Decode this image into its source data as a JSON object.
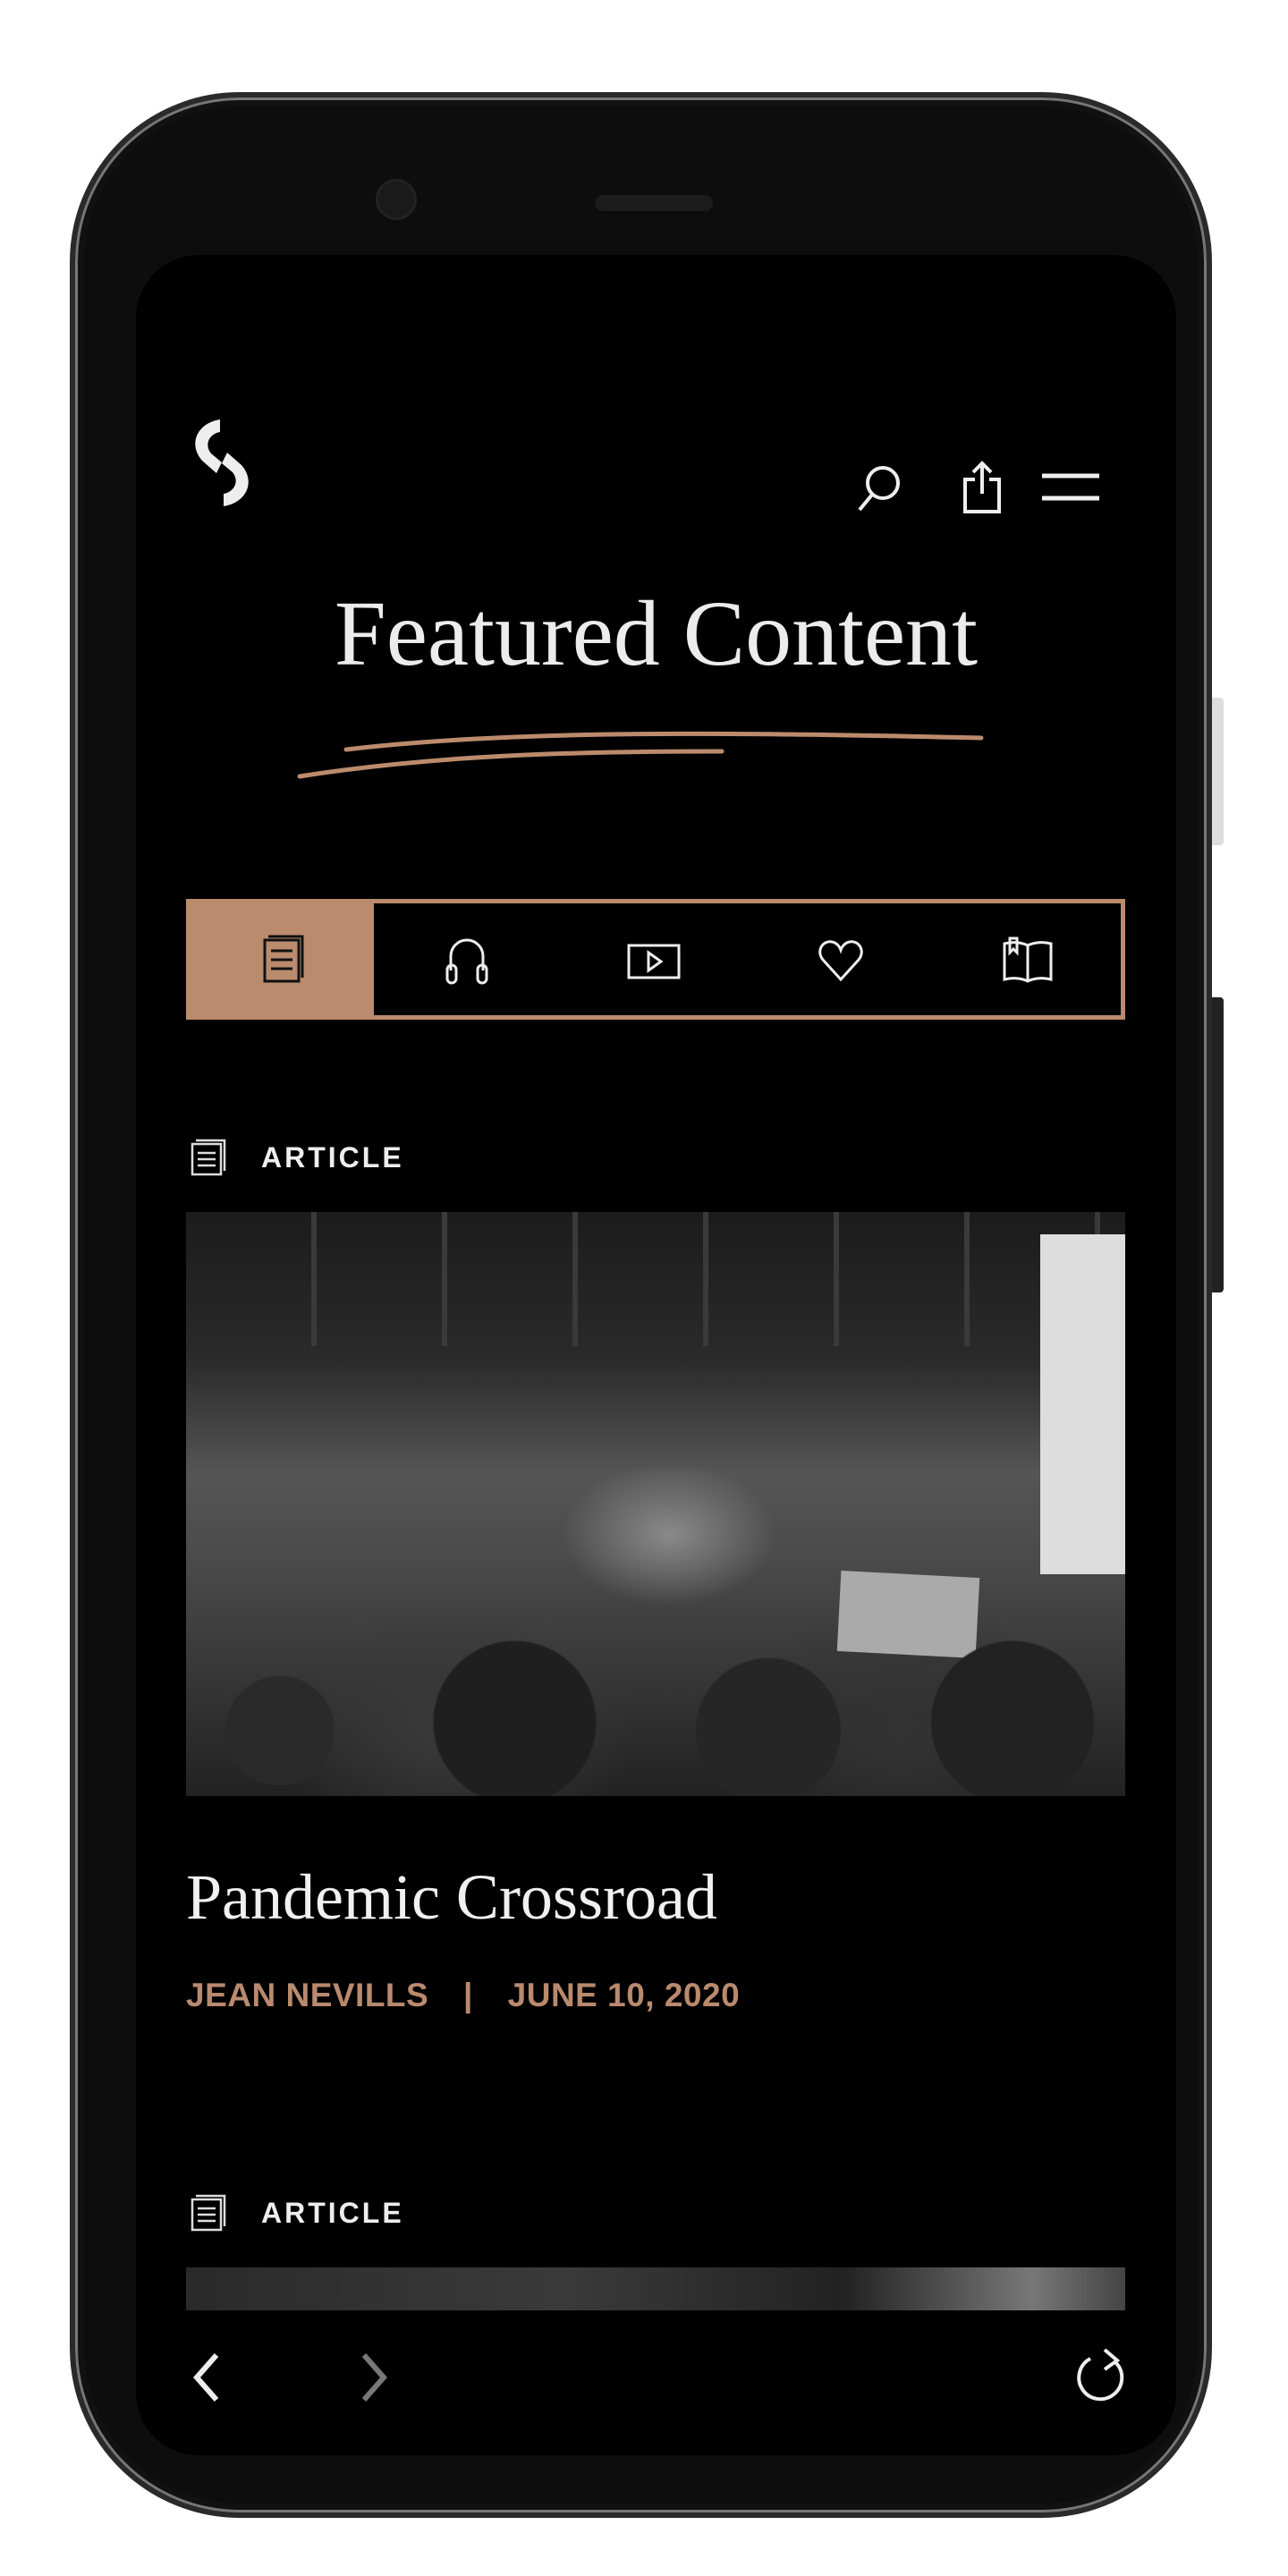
{
  "header": {
    "logo": "S",
    "icons": [
      "search-icon",
      "share-icon",
      "menu-icon"
    ]
  },
  "title": "Featured Content",
  "accent_color": "#bb8b6d",
  "tabs": [
    {
      "icon": "article-icon",
      "active": true
    },
    {
      "icon": "headphones-icon"
    },
    {
      "icon": "video-icon"
    },
    {
      "icon": "heart-icon"
    },
    {
      "icon": "book-icon"
    }
  ],
  "articles": [
    {
      "type": "ARTICLE",
      "title": "Pandemic Crossroad",
      "author": "JEAN NEVILLS",
      "separator": "|",
      "date": "JUNE 10, 2020"
    },
    {
      "type": "ARTICLE"
    }
  ],
  "browser_nav": {
    "icons": [
      "back-icon",
      "forward-icon",
      "refresh-icon"
    ]
  }
}
